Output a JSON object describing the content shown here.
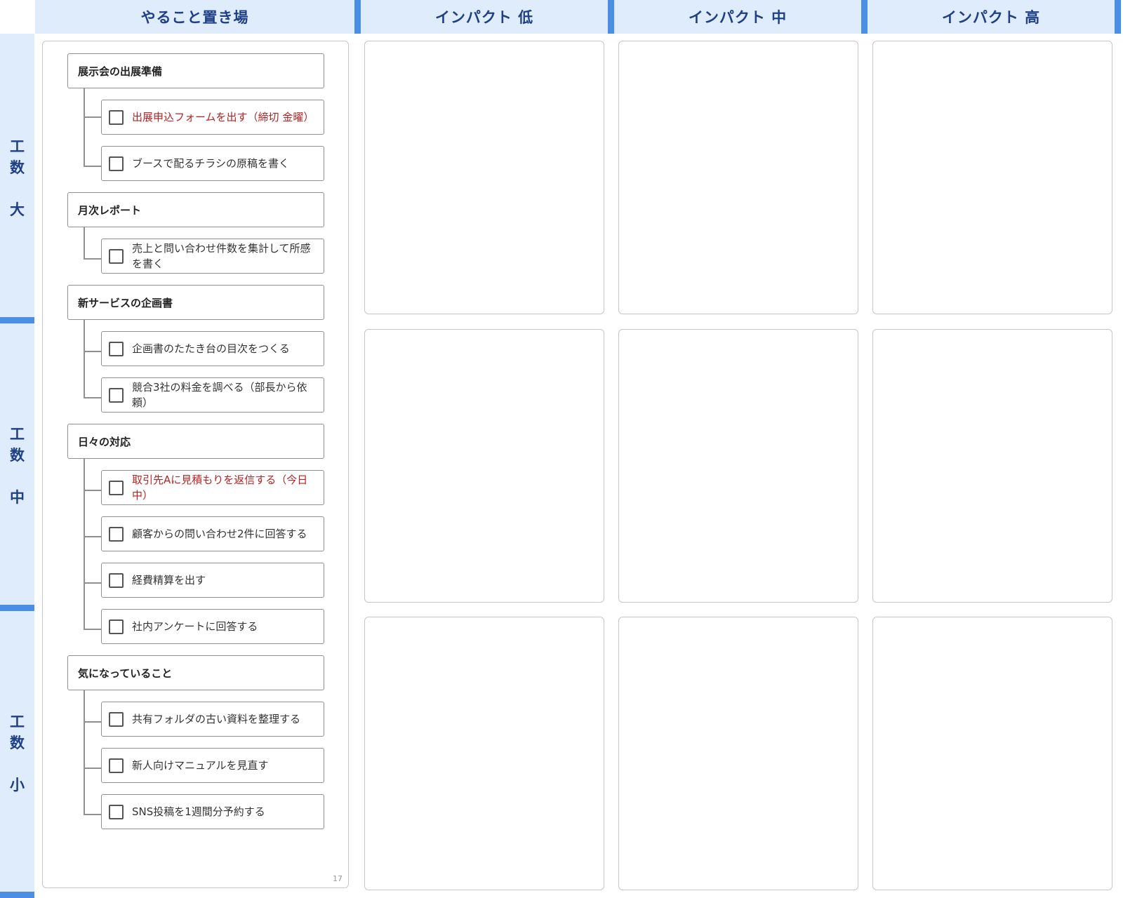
{
  "columns": {
    "todo": "やること置き場",
    "impact_low": "インパクト 低",
    "impact_mid": "インパクト 中",
    "impact_high": "インパクト 高"
  },
  "rows": {
    "effort_large": [
      "工",
      "数",
      "大"
    ],
    "effort_mid": [
      "工",
      "数",
      "中"
    ],
    "effort_small": [
      "工",
      "数",
      "小"
    ]
  },
  "colors": {
    "header_bg": "#deecfb",
    "header_text": "#1f3f86",
    "accent": "#4b8ee6",
    "urgent_text": "#b82222"
  },
  "groups": [
    {
      "title": "展示会の出展準備",
      "tasks": [
        {
          "label": "出展申込フォームを出す（締切 金曜）",
          "urgent": true,
          "checked": false
        },
        {
          "label": "ブースで配るチラシの原稿を書く",
          "urgent": false,
          "checked": false
        }
      ]
    },
    {
      "title": "月次レポート",
      "tasks": [
        {
          "label": "売上と問い合わせ件数を集計して所感を書く",
          "urgent": false,
          "checked": false
        }
      ]
    },
    {
      "title": "新サービスの企画書",
      "tasks": [
        {
          "label": "企画書のたたき台の目次をつくる",
          "urgent": false,
          "checked": false
        },
        {
          "label": "競合3社の料金を調べる（部長から依頼）",
          "urgent": false,
          "checked": false
        }
      ]
    },
    {
      "title": "日々の対応",
      "tasks": [
        {
          "label": "取引先Aに見積もりを返信する（今日中）",
          "urgent": true,
          "checked": false
        },
        {
          "label": "顧客からの問い合わせ2件に回答する",
          "urgent": false,
          "checked": false
        },
        {
          "label": "経費精算を出す",
          "urgent": false,
          "checked": false
        },
        {
          "label": "社内アンケートに回答する",
          "urgent": false,
          "checked": false
        }
      ]
    },
    {
      "title": "気になっていること",
      "tasks": [
        {
          "label": "共有フォルダの古い資料を整理する",
          "urgent": false,
          "checked": false
        },
        {
          "label": "新人向けマニュアルを見直す",
          "urgent": false,
          "checked": false
        },
        {
          "label": "SNS投稿を1週間分予約する",
          "urgent": false,
          "checked": false
        }
      ]
    }
  ],
  "page_number": "17"
}
